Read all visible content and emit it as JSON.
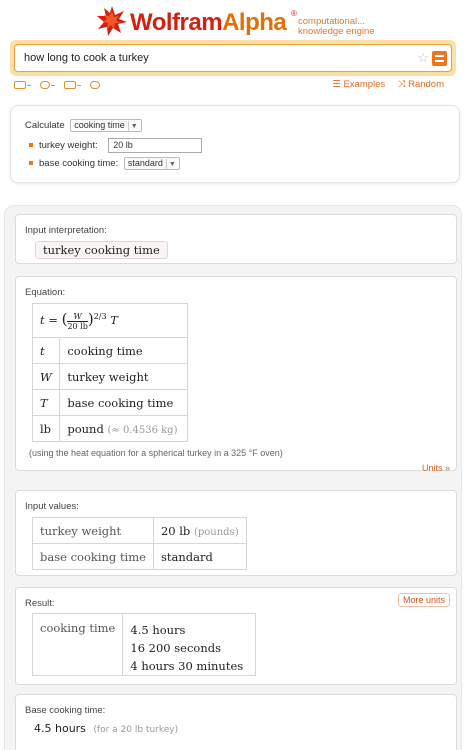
{
  "header": {
    "logo_word1": "Wolfram",
    "logo_word2": "Alpha",
    "tagline_line1": "computational...",
    "tagline_line2": "knowledge engine"
  },
  "search": {
    "query": "how long to cook a turkey",
    "favorite_icon": "star-icon",
    "menu_icon": "equals-icon"
  },
  "toolbar": {
    "examples_label": "Examples",
    "random_label": "Random"
  },
  "assumptions": {
    "calculate_label": "Calculate",
    "calculate_value": "cooking time",
    "weight_label": "turkey weight:",
    "weight_value": "20 lb",
    "base_label": "base cooking time:",
    "base_value": "standard"
  },
  "pods": {
    "input": {
      "title": "Input interpretation:",
      "value": "turkey cooking time"
    },
    "equation": {
      "title": "Equation:",
      "formula_lhs": "t =",
      "formula_num": "W",
      "formula_den": "20 lb",
      "formula_exp": "2/3",
      "formula_rhs": "T",
      "rows": [
        {
          "sym": "t",
          "desc": "cooking time",
          "extra": ""
        },
        {
          "sym": "W",
          "desc": "turkey weight",
          "extra": ""
        },
        {
          "sym": "T",
          "desc": "base cooking time",
          "extra": ""
        },
        {
          "sym": "lb",
          "desc": "pound",
          "extra": "(≈ 0.4536 kg)"
        }
      ],
      "note": "(using the heat equation for a spherical turkey in a 325 °F oven)",
      "units_link": "Units »"
    },
    "values": {
      "title": "Input values:",
      "rows": [
        {
          "label": "turkey weight",
          "value": "20 lb",
          "unit": "(pounds)"
        },
        {
          "label": "base cooking time",
          "value": "standard",
          "unit": ""
        }
      ]
    },
    "result": {
      "title": "Result:",
      "more_units": "More units",
      "label": "cooking time",
      "value1": "4.5 hours",
      "value2": "16 200 seconds",
      "value3": "4 hours 30 minutes"
    },
    "base": {
      "title": "Base cooking time:",
      "value": "4.5 hours",
      "note": "(for a 20 lb turkey)"
    }
  },
  "colors": {
    "brand_red": "#d4200e",
    "accent_orange": "#e8781e"
  }
}
